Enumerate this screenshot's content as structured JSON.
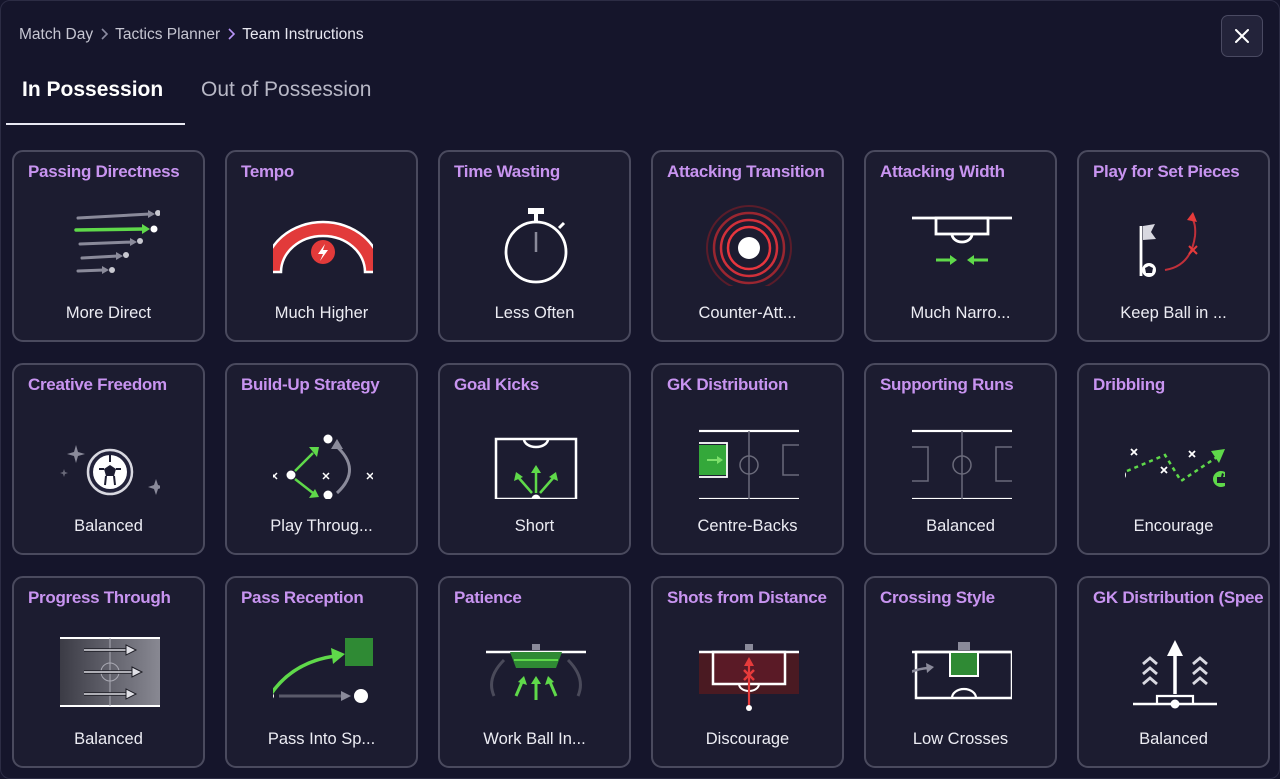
{
  "breadcrumb": {
    "items": [
      "Match Day",
      "Tactics Planner",
      "Team Instructions"
    ]
  },
  "close_icon": "close-icon",
  "tabs": [
    {
      "label": "In Possession",
      "active": true
    },
    {
      "label": "Out of Possession",
      "active": false
    }
  ],
  "colors": {
    "accent_title": "#c894f0",
    "green": "#5fd94a",
    "red": "#e63b3b",
    "card_border": "#4a4a5e"
  },
  "cards": [
    {
      "title": "Passing Directness",
      "value": "More Direct",
      "icon": "passing-directness-icon"
    },
    {
      "title": "Tempo",
      "value": "Much Higher",
      "icon": "tempo-gauge-icon"
    },
    {
      "title": "Time Wasting",
      "value": "Less Often",
      "icon": "stopwatch-icon"
    },
    {
      "title": "Attacking Transition",
      "value": "Counter-Att...",
      "icon": "counter-attack-icon"
    },
    {
      "title": "Attacking Width",
      "value": "Much Narro...",
      "icon": "attacking-width-icon"
    },
    {
      "title": "Play for Set Pieces",
      "value": "Keep Ball in ...",
      "icon": "corner-flag-icon"
    },
    {
      "title": "Creative Freedom",
      "value": "Balanced",
      "icon": "sparkle-ball-icon"
    },
    {
      "title": "Build-Up Strategy",
      "value": "Play Throug...",
      "icon": "build-up-icon"
    },
    {
      "title": "Goal Kicks",
      "value": "Short",
      "icon": "goal-kicks-icon"
    },
    {
      "title": "GK Distribution",
      "value": "Centre-Backs",
      "icon": "gk-distribution-pitch-icon"
    },
    {
      "title": "Supporting Runs",
      "value": "Balanced",
      "icon": "supporting-runs-pitch-icon"
    },
    {
      "title": "Dribbling",
      "value": "Encourage",
      "icon": "dribbling-icon"
    },
    {
      "title": "Progress Through",
      "value": "Balanced",
      "icon": "progress-through-icon"
    },
    {
      "title": "Pass Reception",
      "value": "Pass Into Sp...",
      "icon": "pass-reception-icon"
    },
    {
      "title": "Patience",
      "value": "Work Ball In...",
      "icon": "patience-icon"
    },
    {
      "title": "Shots from Distance",
      "value": "Discourage",
      "icon": "shots-distance-icon"
    },
    {
      "title": "Crossing Style",
      "value": "Low Crosses",
      "icon": "crossing-style-icon"
    },
    {
      "title": "GK Distribution (Speed)",
      "value": "Balanced",
      "icon": "gk-speed-icon"
    }
  ]
}
